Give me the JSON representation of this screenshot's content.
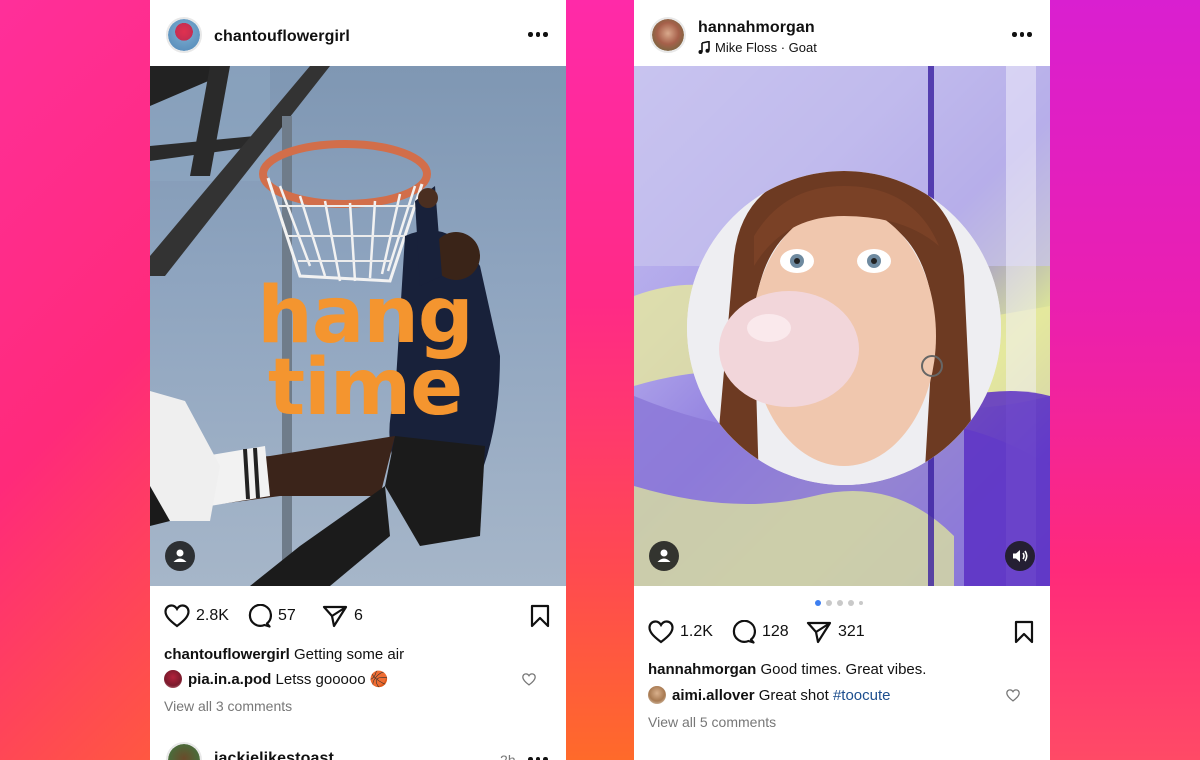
{
  "post1": {
    "username": "chantouflowergirl",
    "overlay_text_line1": "hang",
    "overlay_text_line2": "time",
    "likes": "2.8K",
    "comments": "57",
    "shares": "6",
    "caption_user": "chantouflowergirl",
    "caption_text": "Getting some air",
    "comment_user": "pia.in.a.pod",
    "comment_text": "Letss gooooo 🏀",
    "view_all": "View all 3 comments",
    "next_user": "jackielikestoast",
    "next_time": "2h"
  },
  "post2": {
    "username": "hannahmorgan",
    "music": "Mike Floss · Goat",
    "likes": "1.2K",
    "comments": "128",
    "shares": "321",
    "caption_user": "hannahmorgan",
    "caption_text": "Good times. Great vibes.",
    "comment_user": "aimi.allover",
    "comment_text": "Great shot",
    "comment_hashtag": "#toocute",
    "view_all": "View all 5 comments",
    "carousel_pages": 5,
    "carousel_active": 1
  },
  "icons": [
    "more-icon",
    "user-tag-icon",
    "heart-icon",
    "comment-icon",
    "share-icon",
    "bookmark-icon",
    "volume-icon",
    "music-note-icon"
  ],
  "colors": {
    "overlay_text": "#f4952f",
    "hashtag": "#1c4e8e",
    "carousel_active": "#3d7ff0"
  }
}
